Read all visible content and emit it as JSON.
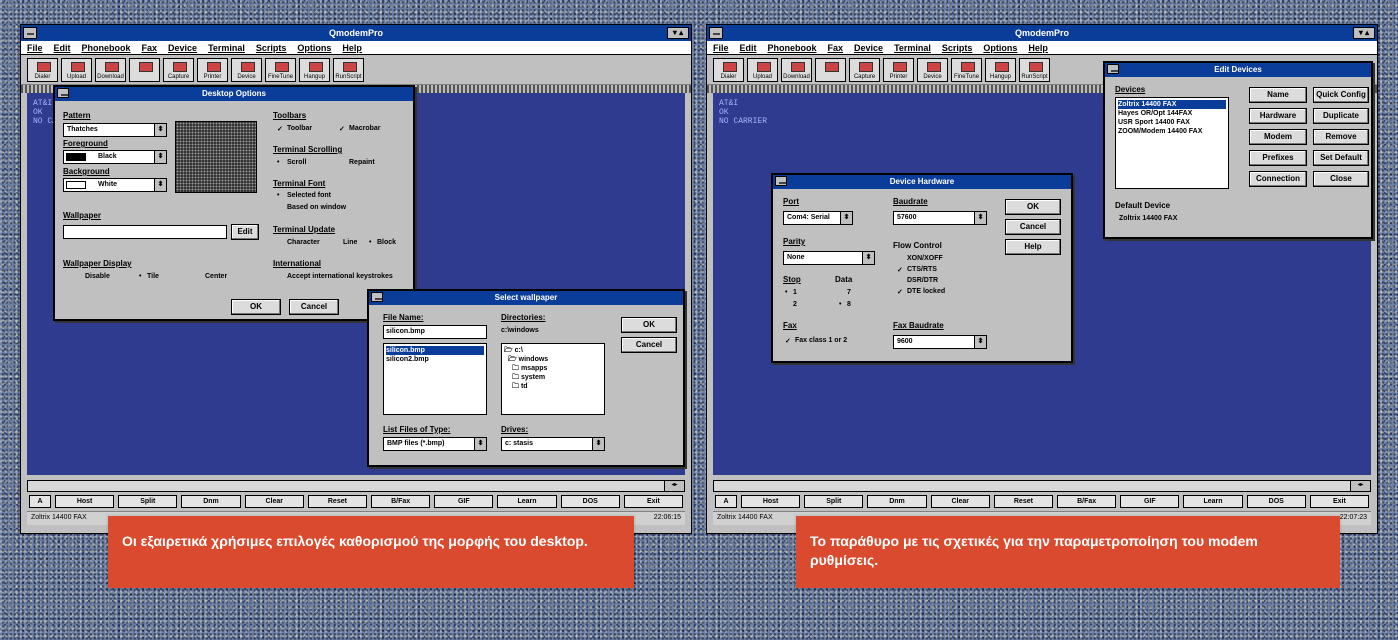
{
  "left": {
    "app_title": "QmodemPro",
    "window_ctrl": "▾ ▴",
    "menu": [
      "File",
      "Edit",
      "Phonebook",
      "Fax",
      "Device",
      "Terminal",
      "Scripts",
      "Options",
      "Help"
    ],
    "toolbar": [
      "Dialer",
      "Upload",
      "Download",
      "",
      "Capture",
      "Printer",
      "Device",
      "FineTune",
      "Hangup",
      "RunScript"
    ],
    "terminal_lines": [
      "AT&I",
      "OK",
      "NO CA"
    ],
    "fkeys": [
      "A",
      "Host",
      "Split",
      "Dnm",
      "Clear",
      "Reset",
      "B/Fax",
      "GIF",
      "Learn",
      "DOS",
      "Exit"
    ],
    "status_left": "Zoltrix 14400 FAX",
    "status_time": "22:06:15",
    "desktop_options": {
      "title": "Desktop Options",
      "pattern_label": "Pattern",
      "pattern_value": "Thatches",
      "foreground_label": "Foreground",
      "foreground_value": "Black",
      "background_label": "Background",
      "background_value": "White",
      "wallpaper_label": "Wallpaper",
      "edit_button": "Edit",
      "wallpaper_display_label": "Wallpaper Display",
      "display_options": [
        "Disable",
        "Tile",
        "Center"
      ],
      "toolbars_label": "Toolbars",
      "toolbar_opts": [
        "Toolbar",
        "Macrobar"
      ],
      "scrolling_label": "Terminal Scrolling",
      "scrolling_opts": [
        "Scroll",
        "Repaint"
      ],
      "font_label": "Terminal Font",
      "font_opts": [
        "Selected font",
        "Based on window"
      ],
      "update_label": "Terminal Update",
      "update_opts": [
        "Character",
        "Line",
        "Block"
      ],
      "international_label": "International",
      "international_opt": "Accept international keystrokes",
      "ok": "OK",
      "cancel": "Cancel"
    },
    "select_wallpaper": {
      "title": "Select wallpaper",
      "file_name_label": "File Name:",
      "file_name_value": "silicon.bmp",
      "files": [
        "silicon.bmp",
        "silicon2.bmp"
      ],
      "directories_label": "Directories:",
      "current_dir": "c:\\windows",
      "dirs": [
        "c:\\",
        "windows",
        "msapps",
        "system",
        "td"
      ],
      "file_types_label": "List Files of Type:",
      "file_types_value": "BMP files (*.bmp)",
      "drives_label": "Drives:",
      "drives_value": "c: stasis",
      "ok": "OK",
      "cancel": "Cancel"
    },
    "caption": "Οι εξαιρετικά χρήσιμες επιλογές καθορισμού της μορφής του desktop."
  },
  "right": {
    "app_title": "QmodemPro",
    "window_ctrl": "▾ ▴",
    "menu": [
      "File",
      "Edit",
      "Phonebook",
      "Fax",
      "Device",
      "Terminal",
      "Scripts",
      "Options",
      "Help"
    ],
    "toolbar": [
      "Dialer",
      "Upload",
      "Download",
      "",
      "Capture",
      "Printer",
      "Device",
      "FineTune",
      "Hangup",
      "RunScript"
    ],
    "terminal_lines": [
      "AT&I",
      "OK",
      "NO CARRIER"
    ],
    "fkeys": [
      "A",
      "Host",
      "Split",
      "Dnm",
      "Clear",
      "Reset",
      "B/Fax",
      "GIF",
      "Learn",
      "DOS",
      "Exit"
    ],
    "status_left": "Zoltrix 14400 FAX",
    "status_time": "22:07:23",
    "edit_devices": {
      "title": "Edit Devices",
      "devices_label": "Devices",
      "devices": [
        "Zoltrix 14400 FAX",
        "Hayes OR/Opt 144FAX",
        "USR Sport 14400 FAX",
        "ZOOM/Modem 14400 FAX"
      ],
      "buttons": [
        "Name",
        "Quick Config",
        "Hardware",
        "Duplicate",
        "Modem",
        "Remove",
        "Prefixes",
        "Set Default",
        "Connection",
        "Close"
      ],
      "default_label": "Default Device",
      "default_value": "Zoltrix 14400 FAX"
    },
    "device_hardware": {
      "title": "Device Hardware",
      "port_label": "Port",
      "port_value": "Com4: Serial",
      "baud_label": "Baudrate",
      "baud_value": "57600",
      "parity_label": "Parity",
      "parity_value": "None",
      "flow_label": "Flow Control",
      "flow_opts": [
        "XON/XOFF",
        "CTS/RTS",
        "DSR/DTR",
        "DTE locked"
      ],
      "stop_label": "Stop",
      "stop_opts": [
        "1",
        "2"
      ],
      "data_label": "Data",
      "data_opts": [
        "7",
        "8"
      ],
      "fax_label": "Fax",
      "fax_opt": "Fax class 1 or 2",
      "fax_baud_label": "Fax Baudrate",
      "fax_baud_value": "9600",
      "ok": "OK",
      "cancel": "Cancel",
      "help": "Help"
    },
    "caption": "Το παράθυρο με τις σχετικές για την παραμετροποίηση του modem ρυθμίσεις."
  }
}
